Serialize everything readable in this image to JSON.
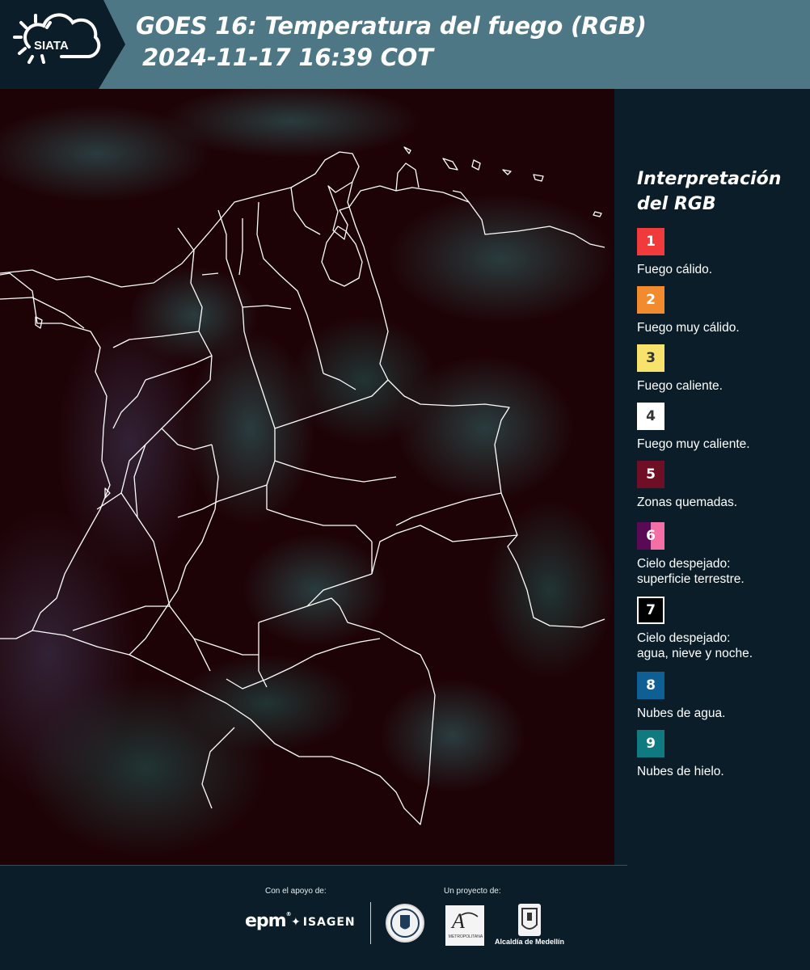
{
  "header": {
    "title_line1": "GOES 16: Temperatura del fuego (RGB)",
    "title_line2": "2024-11-17 16:39 COT",
    "logo_text": "SIATA",
    "logo_icon": "sun-cloud-icon"
  },
  "legend": {
    "title_line1": "Interpretación",
    "title_line2": "del RGB",
    "items": [
      {
        "num": "1",
        "label": "Fuego cálido.",
        "color": "#f03a3c",
        "text_color": "#ffffff"
      },
      {
        "num": "2",
        "label": "Fuego muy cálido.",
        "color": "#f28a2e",
        "text_color": "#ffffff"
      },
      {
        "num": "3",
        "label": "Fuego caliente.",
        "color": "#f7e36b",
        "text_color": "#333333"
      },
      {
        "num": "4",
        "label": "Fuego muy caliente.",
        "color": "#ffffff",
        "text_color": "#333333"
      },
      {
        "num": "5",
        "label": "Zonas quemadas.",
        "color": "#6e0f25",
        "text_color": "#ffffff"
      },
      {
        "num": "6",
        "label": "Cielo despejado:\nsuperficie terrestre.",
        "color": "#5a0a55",
        "color2": "#f36fa6",
        "text_color": "#ffffff"
      },
      {
        "num": "7",
        "label": "Cielo despejado:\nagua, nieve y noche.",
        "color": "#000000",
        "border": "#ffffff",
        "text_color": "#ffffff"
      },
      {
        "num": "8",
        "label": "Nubes de agua.",
        "color": "#0e5f94",
        "text_color": "#ffffff"
      },
      {
        "num": "9",
        "label": "Nubes de hielo.",
        "color": "#0f7a80",
        "text_color": "#ffffff"
      }
    ]
  },
  "footer": {
    "support_caption": "Con el apoyo de:",
    "project_caption": "Un proyecto de:",
    "epm": "epm",
    "isagen": "ISAGEN",
    "area_text": "METROPOLITANA",
    "medellin": "Alcaldía de Medellín"
  },
  "colors": {
    "header_band": "#4e7785",
    "header_dark": "#0b1d28",
    "map_background": "#1e0306",
    "borders": "#ffffff"
  }
}
